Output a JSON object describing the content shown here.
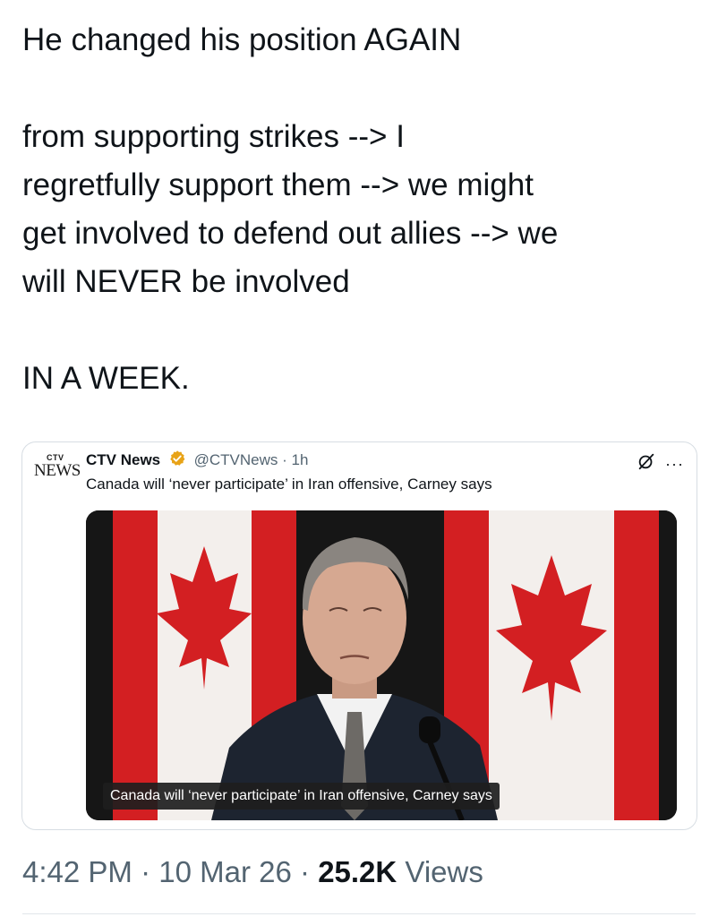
{
  "tweet": {
    "lines_block1": [
      "He changed his position AGAIN"
    ],
    "lines_block2": [
      "from supporting strikes  --> I",
      "regretfully support them --> we might",
      "get involved to defend out allies --> we",
      "will NEVER be involved"
    ],
    "lines_block3": [
      "IN A WEEK."
    ]
  },
  "quote": {
    "logo_top": "CTV",
    "logo_bottom": "NEWS",
    "name": "CTV News",
    "handle": "@CTVNews",
    "separator": "·",
    "age": "1h",
    "headline": "Canada will ‘never participate’ in Iran offensive, Carney says",
    "media_caption": "Canada will ‘never participate’ in Iran offensive, Carney says",
    "more": "···",
    "verified_color": "#f4b400"
  },
  "meta": {
    "time": "4:42 PM",
    "dot1": "·",
    "date": "10 Mar 26",
    "dot2": "·",
    "views_count": "25.2K",
    "views_label": "Views"
  }
}
